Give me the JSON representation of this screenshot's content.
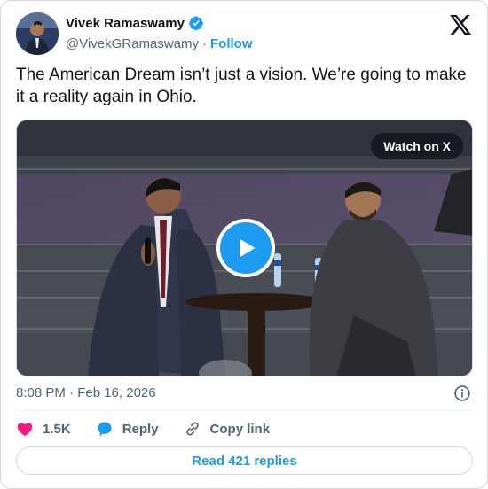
{
  "author": {
    "name": "Vivek Ramaswamy",
    "handle": "@VivekGRamaswamy",
    "separator": "·",
    "follow_label": "Follow"
  },
  "tweet": {
    "text": "The American Dream isn’t just a vision. We’re going to make it a reality again in Ohio.",
    "timestamp": "8:08 PM · Feb 16, 2026"
  },
  "media": {
    "watch_label": "Watch on X"
  },
  "actions": {
    "likes": "1.5K",
    "reply_label": "Reply",
    "copy_label": "Copy link"
  },
  "read_replies_label": "Read 421 replies",
  "colors": {
    "accent": "#1d9bf0",
    "like": "#f91880",
    "muted_text": "#536471"
  },
  "icons": [
    "verified-badge-icon",
    "x-logo-icon",
    "play-icon",
    "info-icon",
    "heart-icon",
    "reply-bubble-icon",
    "link-icon"
  ]
}
